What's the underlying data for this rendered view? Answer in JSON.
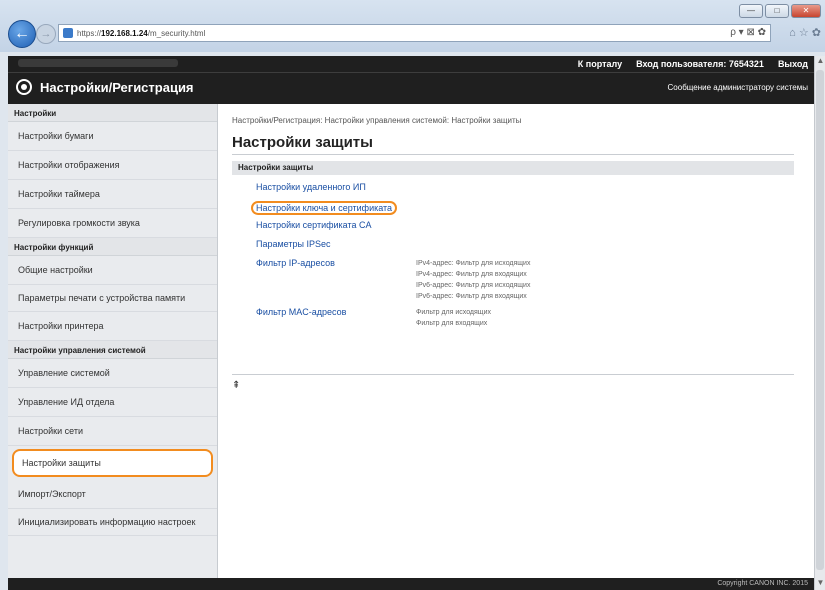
{
  "browser": {
    "url_prefix": "https://",
    "url_host": "192.168.1.24",
    "url_path": "/m_security.html",
    "win_min": "—",
    "win_max": "□",
    "win_close": "✕",
    "back_icon": "←",
    "forward_icon": "→",
    "address_tools": "ρ ▾ ⊠ ✿",
    "toolbar_icons": "⌂ ☆ ✿"
  },
  "header": {
    "portal_link": "К порталу",
    "login_label": "Вход пользователя:",
    "login_user": "7654321",
    "logout_link": "Выход",
    "title": "Настройки/Регистрация",
    "admin_message": "Сообщение администратору системы"
  },
  "sidebar": {
    "sections": [
      {
        "title": "Настройки",
        "items": [
          {
            "label": "Настройки бумаги"
          },
          {
            "label": "Настройки отображения"
          },
          {
            "label": "Настройки таймера"
          },
          {
            "label": "Регулировка громкости звука"
          }
        ]
      },
      {
        "title": "Настройки функций",
        "items": [
          {
            "label": "Общие настройки"
          },
          {
            "label": "Параметры печати с устройства памяти"
          },
          {
            "label": "Настройки принтера"
          }
        ]
      },
      {
        "title": "Настройки управления системой",
        "items": [
          {
            "label": "Управление системой"
          },
          {
            "label": "Управление ИД отдела"
          },
          {
            "label": "Настройки сети"
          },
          {
            "label": "Настройки защиты"
          },
          {
            "label": "Импорт/Экспорт"
          },
          {
            "label": "Инициализировать информацию настроек"
          }
        ]
      }
    ]
  },
  "main": {
    "breadcrumb": "Настройки/Регистрация: Настройки управления системой: Настройки защиты",
    "title": "Настройки защиты",
    "section_title": "Настройки защиты",
    "links": [
      {
        "label": "Настройки удаленного ИП"
      },
      {
        "label": "Настройки ключа и сертификата"
      },
      {
        "label": "Настройки сертификата CA"
      },
      {
        "label": "Параметры IPSec"
      }
    ],
    "ip_filter": {
      "label": "Фильтр IP-адресов",
      "descriptions": [
        "IPv4-адрес: Фильтр для исходящих",
        "IPv4-адрес: Фильтр для входящих",
        "IPv6-адрес: Фильтр для исходящих",
        "IPv6-адрес: Фильтр для входящих"
      ]
    },
    "mac_filter": {
      "label": "Фильтр MAC-адресов",
      "descriptions": [
        "Фильтр для исходящих",
        "Фильтр для входящих"
      ]
    },
    "top_icon": "⇞"
  },
  "footer": {
    "copyright": "Copyright CANON INC. 2015"
  },
  "scrollbar": {
    "up_icon": "▲",
    "down_icon": "▼"
  },
  "colors": {
    "accent_highlight": "#f28c1f",
    "link": "#1a4fa3",
    "header_bg": "#1f1f1f"
  }
}
